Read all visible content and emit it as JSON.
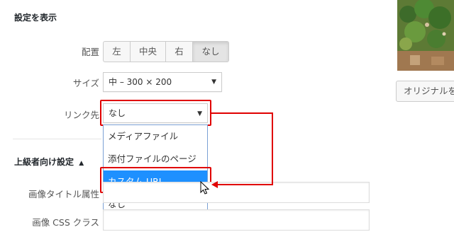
{
  "settings": {
    "section_title": "設定を表示",
    "align": {
      "label": "配置",
      "options": [
        "左",
        "中央",
        "右",
        "なし"
      ],
      "selected": "なし"
    },
    "size": {
      "label": "サイズ",
      "value": "中 – 300 × 200"
    },
    "link": {
      "label": "リンク先",
      "value": "なし",
      "dropdown_options": [
        "メディアファイル",
        "添付ファイルのページ",
        "カスタム URL",
        "なし"
      ],
      "highlighted": "カスタム URL"
    }
  },
  "advanced": {
    "title": "上級者向け設定",
    "toggle_icon": "triangle-up-icon",
    "image_title_label": "画像タイトル属性",
    "image_css_label": "画像 CSS クラス"
  },
  "side": {
    "original_button": "オリジナルを"
  },
  "colors": {
    "highlight_blue": "#1e90ff",
    "annotation_red": "#e00000"
  }
}
